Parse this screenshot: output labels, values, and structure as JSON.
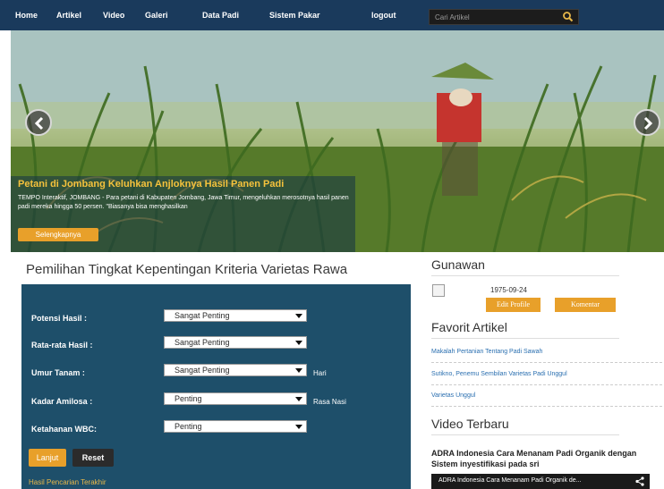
{
  "nav": {
    "items": [
      "Home",
      "Artikel",
      "Video",
      "Galeri",
      "Data Padi",
      "Sistem Pakar",
      "logout"
    ],
    "search_placeholder": "Cari Artikel"
  },
  "hero": {
    "title": "Petani di Jombang Keluhkan Anjloknya Hasil Panen Padi",
    "text": "TEMPO Interaktif, JOMBANG - Para petani di Kabupaten Jombang, Jawa Timur, mengeluhkan merosotnya hasil panen padi mereka hingga 50 persen. \"Biasanya bisa menghasilkan",
    "button": "Selengkapnya"
  },
  "form": {
    "title": "Pemilihan Tingkat Kepentingan Kriteria Varietas Rawa",
    "rows": [
      {
        "label": "Potensi Hasil     :",
        "value": "Sangat Penting",
        "unit": ""
      },
      {
        "label": "Rata-rata Hasil    :",
        "value": "Sangat Penting",
        "unit": ""
      },
      {
        "label": "Umur Tanam     :",
        "value": "Sangat Penting",
        "unit": "Hari"
      },
      {
        "label": "Kadar Amilosa    :",
        "value": "Penting",
        "unit": "Rasa Nasi"
      },
      {
        "label": "Ketahanan WBC:",
        "value": "Penting",
        "unit": ""
      }
    ],
    "submit": "Lanjut",
    "reset": "Reset",
    "history_link": "Hasil Pencarian Terakhir"
  },
  "sidebar": {
    "username": "Gunawan",
    "birthdate": "1975-09-24",
    "edit_profile": "Edit Profile",
    "comment": "Komentar",
    "favorit_title": "Favorit Artikel",
    "favorit_links": [
      "Makalah Pertanian Tentang Padi Sawah",
      "Sutikno, Penemu Sembilan Varietas Padi Unggul",
      "Varietas Unggul"
    ],
    "video_heading": "Video Terbaru",
    "video_title": "ADRA Indonesia Cara Menanam Padi Organik dengan Sistem inyestifikasi pada sri",
    "video_bar": "ADRA Indonesia Cara Menanam Padi Organik de..."
  },
  "colors": {
    "nav_bg": "#1a3a5c",
    "panel_bg": "#1e4f6a",
    "accent": "#e8a02a",
    "link": "#2a6fb0",
    "caption_title": "#f5c23c"
  },
  "icons": [
    "search-icon",
    "chevron-left-icon",
    "chevron-right-icon",
    "share-icon",
    "avatar-broken-image-icon"
  ]
}
